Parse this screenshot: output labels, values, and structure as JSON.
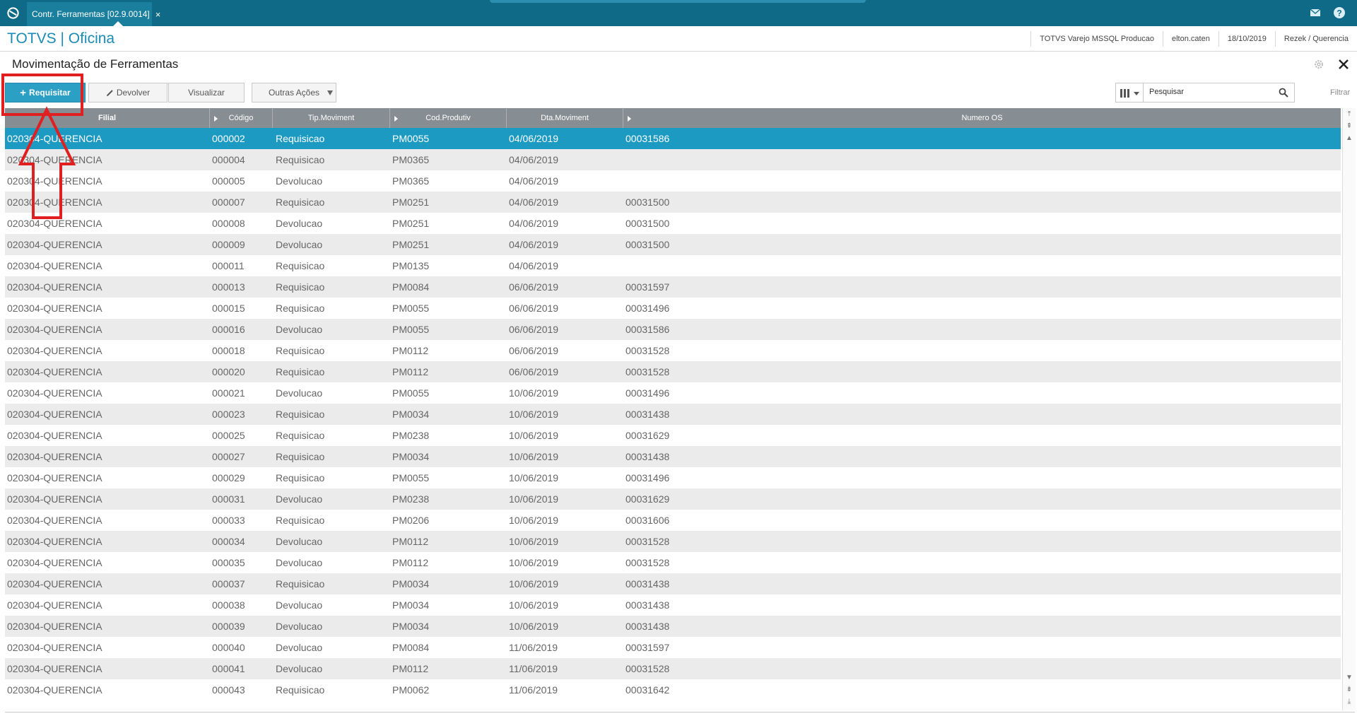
{
  "window": {
    "tab_title": "Contr. Ferramentas [02.9.0014]",
    "tab_close": "×"
  },
  "header": {
    "brand": "TOTVS | Oficina",
    "environment": "TOTVS Varejo MSSQL Producao",
    "user": "elton.caten",
    "date": "18/10/2019",
    "branch": "Rezek / Querencia"
  },
  "page": {
    "title": "Movimentação de Ferramentas"
  },
  "toolbar": {
    "requisitar_label": "Requisitar",
    "devolver_label": "Devolver",
    "visualizar_label": "Visualizar",
    "outras_acoes_label": "Outras Ações",
    "search_placeholder": "Pesquisar",
    "filtrar_label": "Filtrar"
  },
  "grid": {
    "columns": [
      "Filial",
      "Código",
      "Tip.Moviment",
      "Cod.Produtiv",
      "Dta.Moviment",
      "Numero OS"
    ],
    "rows": [
      [
        "020304-QUERENCIA",
        "000002",
        "Requisicao",
        "PM0055",
        "04/06/2019",
        "00031586"
      ],
      [
        "020304-QUERENCIA",
        "000004",
        "Requisicao",
        "PM0365",
        "04/06/2019",
        ""
      ],
      [
        "020304-QUERENCIA",
        "000005",
        "Devolucao",
        "PM0365",
        "04/06/2019",
        ""
      ],
      [
        "020304-QUERENCIA",
        "000007",
        "Requisicao",
        "PM0251",
        "04/06/2019",
        "00031500"
      ],
      [
        "020304-QUERENCIA",
        "000008",
        "Devolucao",
        "PM0251",
        "04/06/2019",
        "00031500"
      ],
      [
        "020304-QUERENCIA",
        "000009",
        "Devolucao",
        "PM0251",
        "04/06/2019",
        "00031500"
      ],
      [
        "020304-QUERENCIA",
        "000011",
        "Requisicao",
        "PM0135",
        "04/06/2019",
        ""
      ],
      [
        "020304-QUERENCIA",
        "000013",
        "Requisicao",
        "PM0084",
        "06/06/2019",
        "00031597"
      ],
      [
        "020304-QUERENCIA",
        "000015",
        "Requisicao",
        "PM0055",
        "06/06/2019",
        "00031496"
      ],
      [
        "020304-QUERENCIA",
        "000016",
        "Devolucao",
        "PM0055",
        "06/06/2019",
        "00031586"
      ],
      [
        "020304-QUERENCIA",
        "000018",
        "Requisicao",
        "PM0112",
        "06/06/2019",
        "00031528"
      ],
      [
        "020304-QUERENCIA",
        "000020",
        "Requisicao",
        "PM0112",
        "06/06/2019",
        "00031528"
      ],
      [
        "020304-QUERENCIA",
        "000021",
        "Devolucao",
        "PM0055",
        "10/06/2019",
        "00031496"
      ],
      [
        "020304-QUERENCIA",
        "000023",
        "Requisicao",
        "PM0034",
        "10/06/2019",
        "00031438"
      ],
      [
        "020304-QUERENCIA",
        "000025",
        "Requisicao",
        "PM0238",
        "10/06/2019",
        "00031629"
      ],
      [
        "020304-QUERENCIA",
        "000027",
        "Requisicao",
        "PM0034",
        "10/06/2019",
        "00031438"
      ],
      [
        "020304-QUERENCIA",
        "000029",
        "Requisicao",
        "PM0055",
        "10/06/2019",
        "00031496"
      ],
      [
        "020304-QUERENCIA",
        "000031",
        "Devolucao",
        "PM0238",
        "10/06/2019",
        "00031629"
      ],
      [
        "020304-QUERENCIA",
        "000033",
        "Requisicao",
        "PM0206",
        "10/06/2019",
        "00031606"
      ],
      [
        "020304-QUERENCIA",
        "000034",
        "Devolucao",
        "PM0112",
        "10/06/2019",
        "00031528"
      ],
      [
        "020304-QUERENCIA",
        "000035",
        "Devolucao",
        "PM0112",
        "10/06/2019",
        "00031528"
      ],
      [
        "020304-QUERENCIA",
        "000037",
        "Requisicao",
        "PM0034",
        "10/06/2019",
        "00031438"
      ],
      [
        "020304-QUERENCIA",
        "000038",
        "Devolucao",
        "PM0034",
        "10/06/2019",
        "00031438"
      ],
      [
        "020304-QUERENCIA",
        "000039",
        "Devolucao",
        "PM0034",
        "10/06/2019",
        "00031438"
      ],
      [
        "020304-QUERENCIA",
        "000040",
        "Devolucao",
        "PM0084",
        "11/06/2019",
        "00031597"
      ],
      [
        "020304-QUERENCIA",
        "000041",
        "Devolucao",
        "PM0112",
        "11/06/2019",
        "00031528"
      ],
      [
        "020304-QUERENCIA",
        "000043",
        "Requisicao",
        "PM0062",
        "11/06/2019",
        "00031642"
      ]
    ],
    "selected_row": 0
  },
  "colors": {
    "topbar": "#0e6a86",
    "accent": "#2b9fc4",
    "selected_row": "#1d9ac1",
    "grid_header": "#868e93",
    "annotation": "#e02020"
  }
}
